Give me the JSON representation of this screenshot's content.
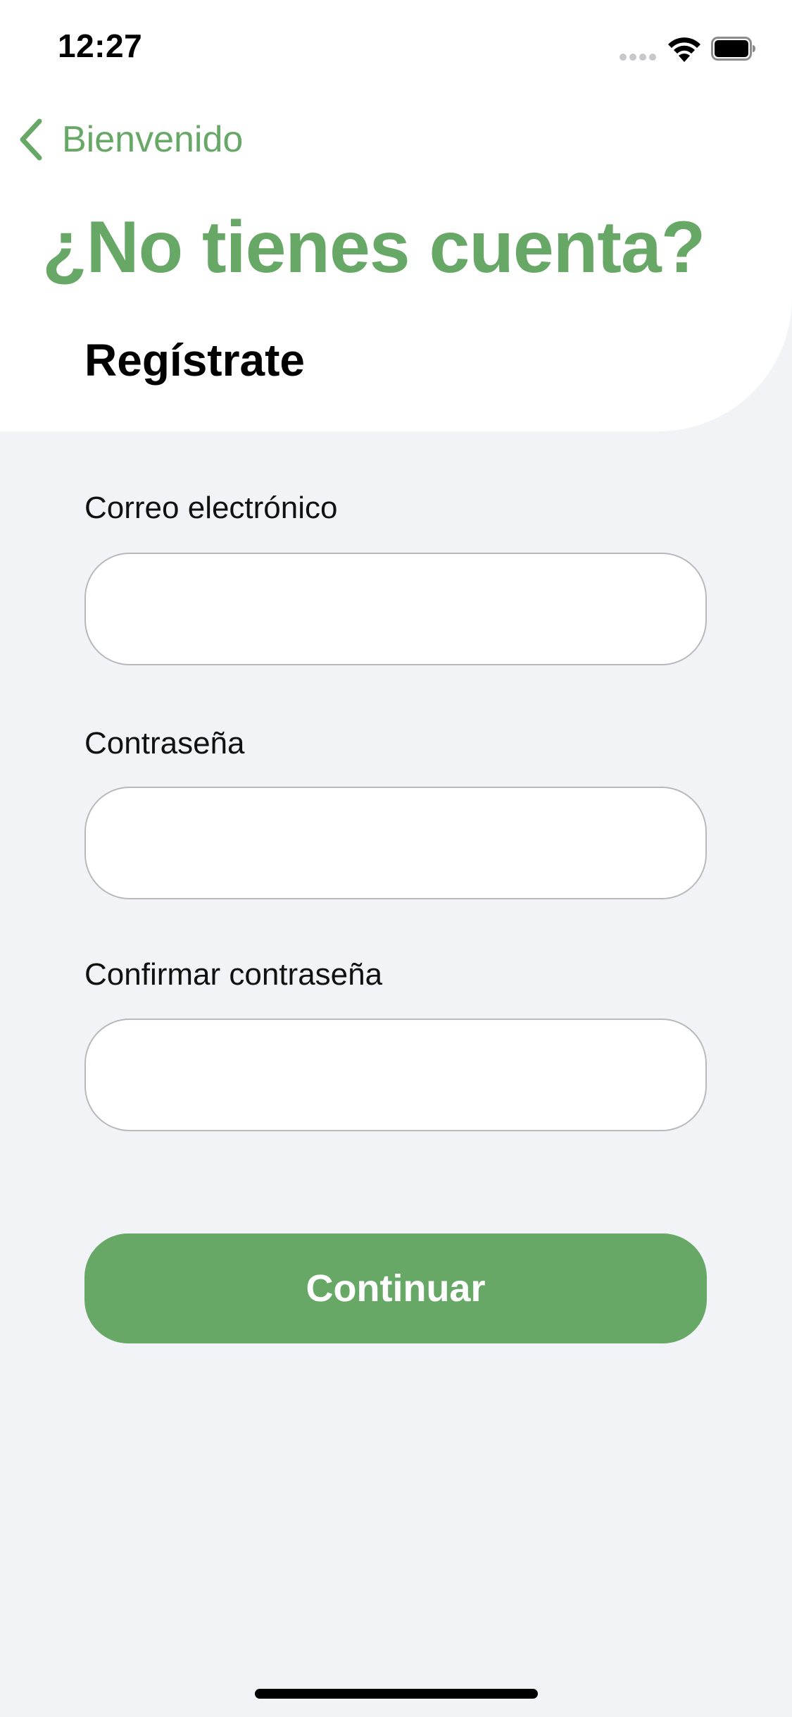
{
  "status_bar": {
    "time": "12:27",
    "signal_icon": "cellular-signal-icon",
    "wifi_icon": "wifi-icon",
    "battery_icon": "battery-icon"
  },
  "nav": {
    "back_icon": "chevron-left-icon",
    "back_label": "Bienvenido"
  },
  "header": {
    "title": "¿No tienes cuenta?",
    "subtitle": "Regístrate"
  },
  "form": {
    "email_label": "Correo electrónico",
    "email_value": "",
    "password_label": "Contraseña",
    "password_value": "",
    "confirm_label": "Confirmar contraseña",
    "confirm_value": "",
    "submit_label": "Continuar"
  },
  "colors": {
    "accent": "#67a866",
    "background": "#f2f3f7",
    "card": "#ffffff"
  }
}
